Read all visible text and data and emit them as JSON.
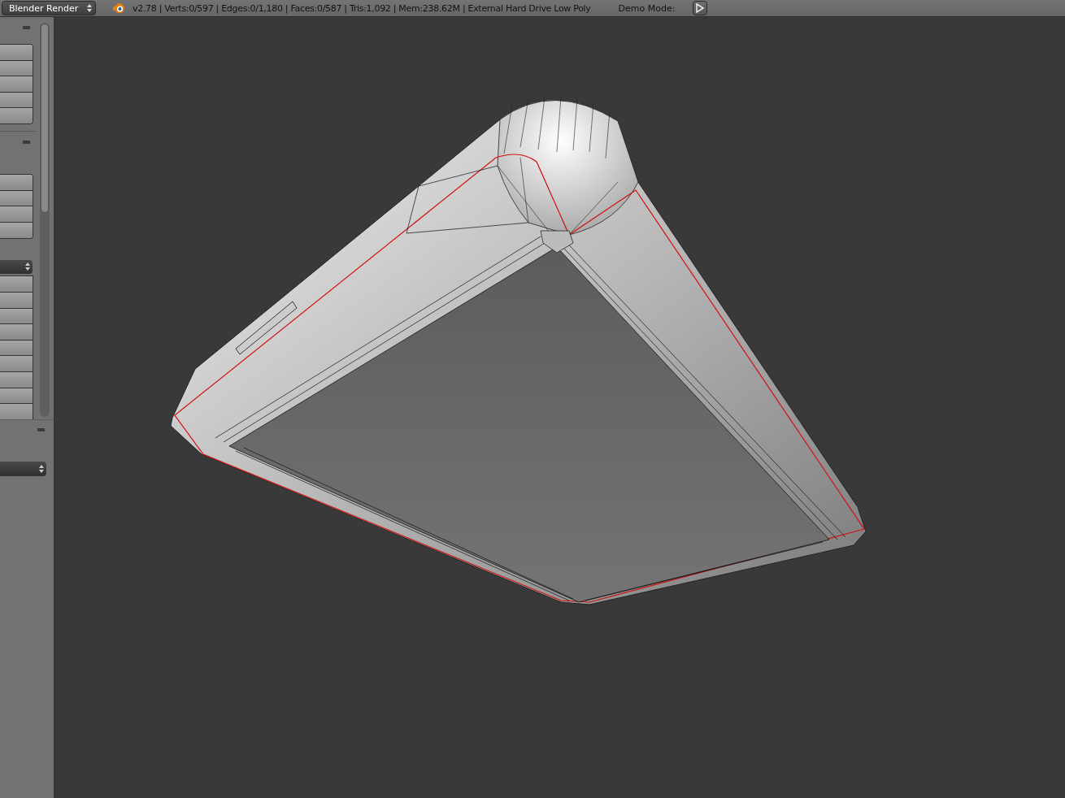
{
  "header": {
    "render_engine": "Blender Render",
    "info": "v2.78 | Verts:0/597 | Edges:0/1,180 | Faces:0/587 | Tris:1,092 | Mem:238.62M | External Hard Drive Low Poly",
    "demo_mode_label": "Demo Mode:"
  }
}
